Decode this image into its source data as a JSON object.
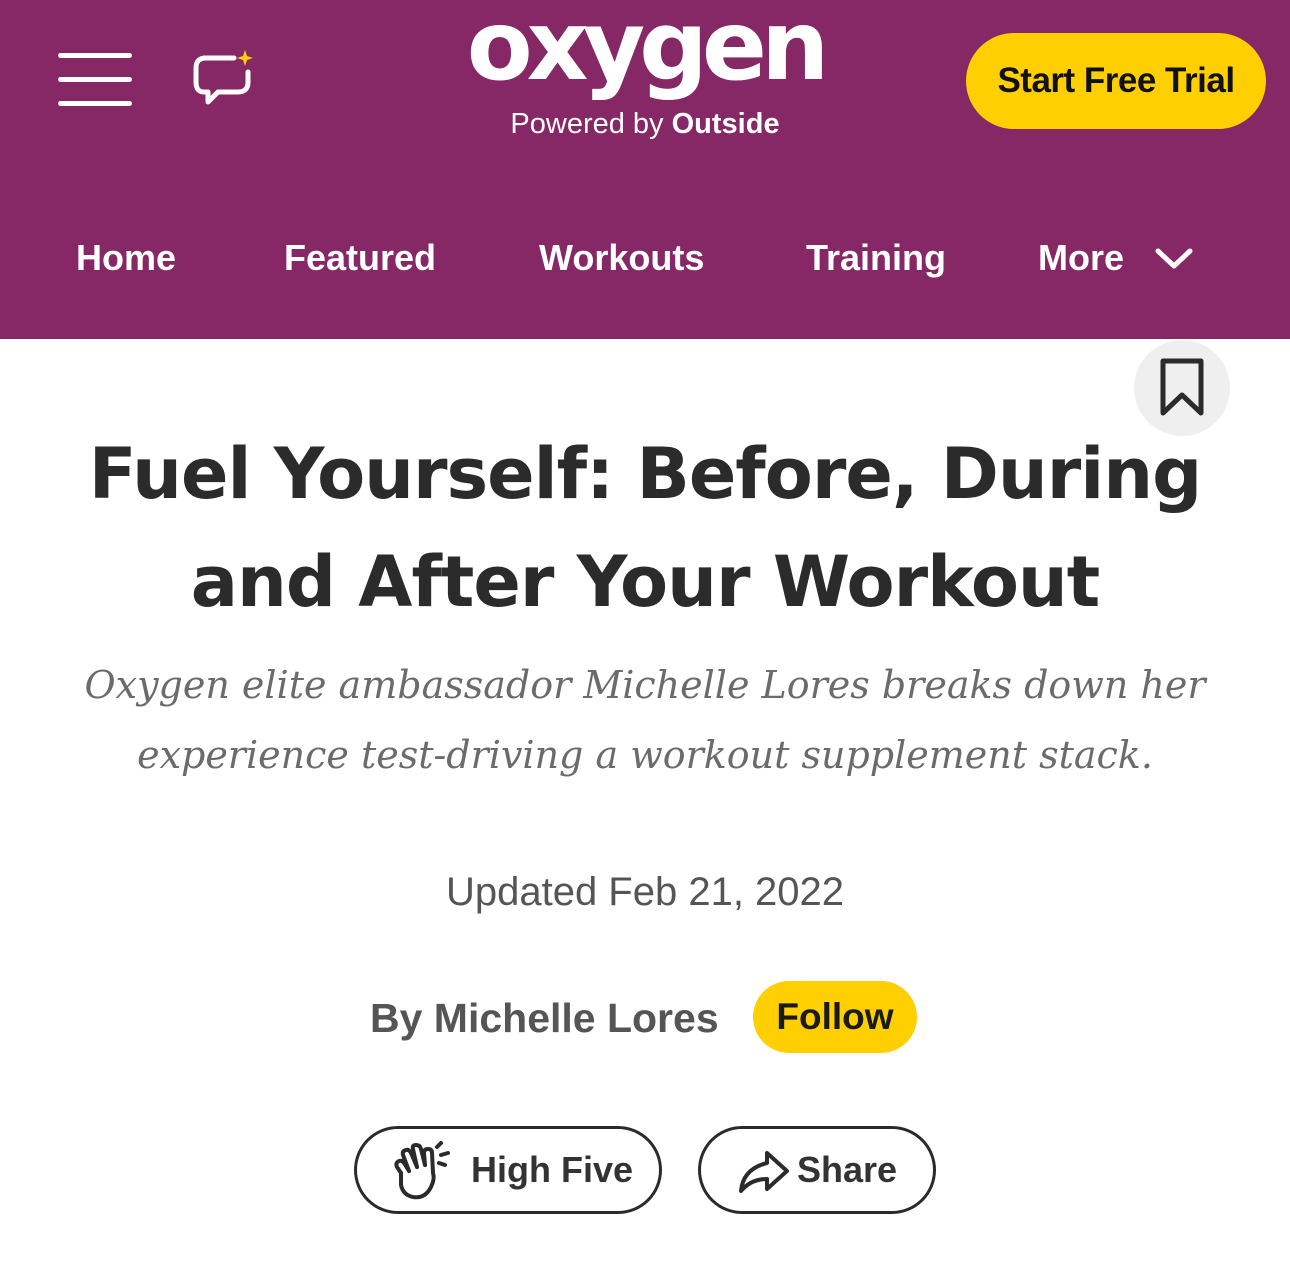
{
  "header": {
    "brand_logo": "oxygen",
    "powered_by_prefix": "Powered by",
    "powered_by_name": "Outside",
    "cta_label": "Start Free Trial",
    "menu_icon": "hamburger-menu-icon",
    "chat_icon": "chat-sparkle-icon"
  },
  "nav": {
    "items": [
      {
        "label": "Home"
      },
      {
        "label": "Featured"
      },
      {
        "label": "Workouts"
      },
      {
        "label": "Training"
      },
      {
        "label": "More"
      }
    ],
    "more_icon": "chevron-down-icon"
  },
  "article": {
    "bookmark_icon": "bookmark-icon",
    "title": "Fuel Yourself: Before, During and After Your Workout",
    "subtitle": "Oxygen elite ambassador Michelle Lores breaks down her experience test-driving a workout supplement stack.",
    "updated": "Updated Feb 21, 2022",
    "byline": "By Michelle Lores",
    "follow_label": "Follow",
    "high_five_label": "High Five",
    "share_label": "Share"
  },
  "colors": {
    "header_bg": "#862865",
    "accent_yellow": "#ffcf01",
    "text_dark": "#2b2b2b",
    "text_muted": "#6b6b6b"
  }
}
